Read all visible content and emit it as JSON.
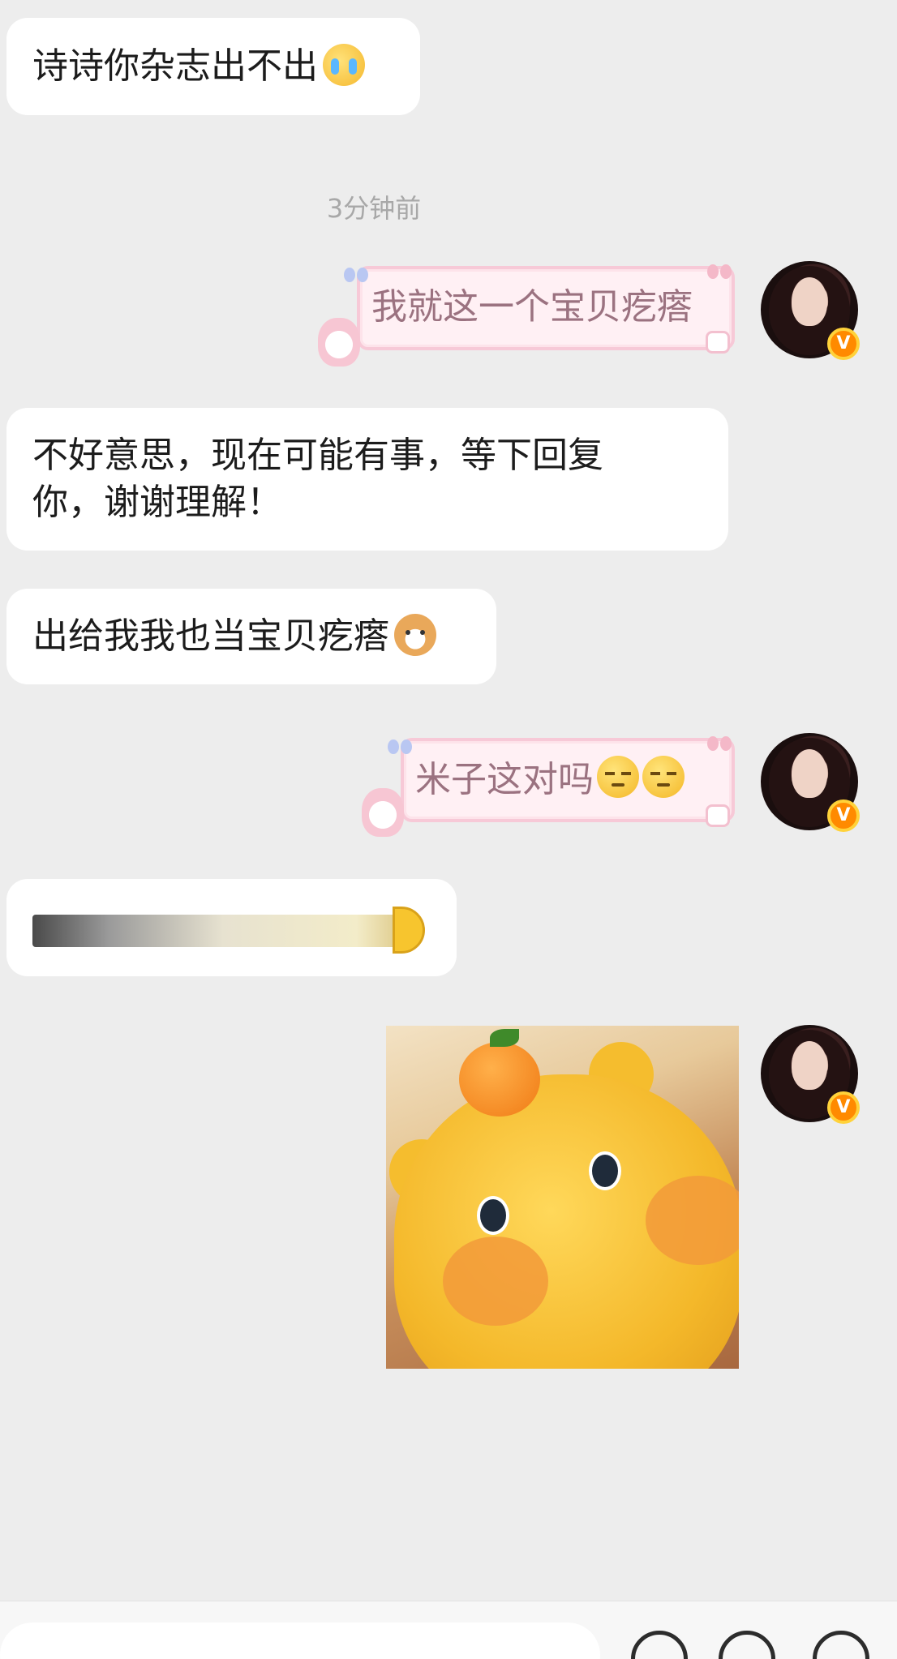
{
  "messages": {
    "m1": {
      "text": "诗诗你杂志出不出",
      "emoji": "crying-face"
    },
    "timestamp": "3分钟前",
    "m2": {
      "text": "我就这一个宝贝疙瘩"
    },
    "m3": {
      "line1": "不好意思，现在可能有事，等下回复",
      "line2": "你，谢谢理解！"
    },
    "m4": {
      "text": "出给我我也当宝贝疙瘩",
      "emoji": "dog-face"
    },
    "m5": {
      "text": "米子这对吗",
      "emoji": "smirking-face"
    },
    "m6": {
      "type": "voice"
    },
    "m7": {
      "type": "image",
      "subject": "yellow-bear-with-orange"
    }
  },
  "avatar": {
    "badge": "V"
  },
  "input": {
    "icons": [
      "emoji-icon",
      "sticker-icon",
      "plus-icon"
    ]
  }
}
